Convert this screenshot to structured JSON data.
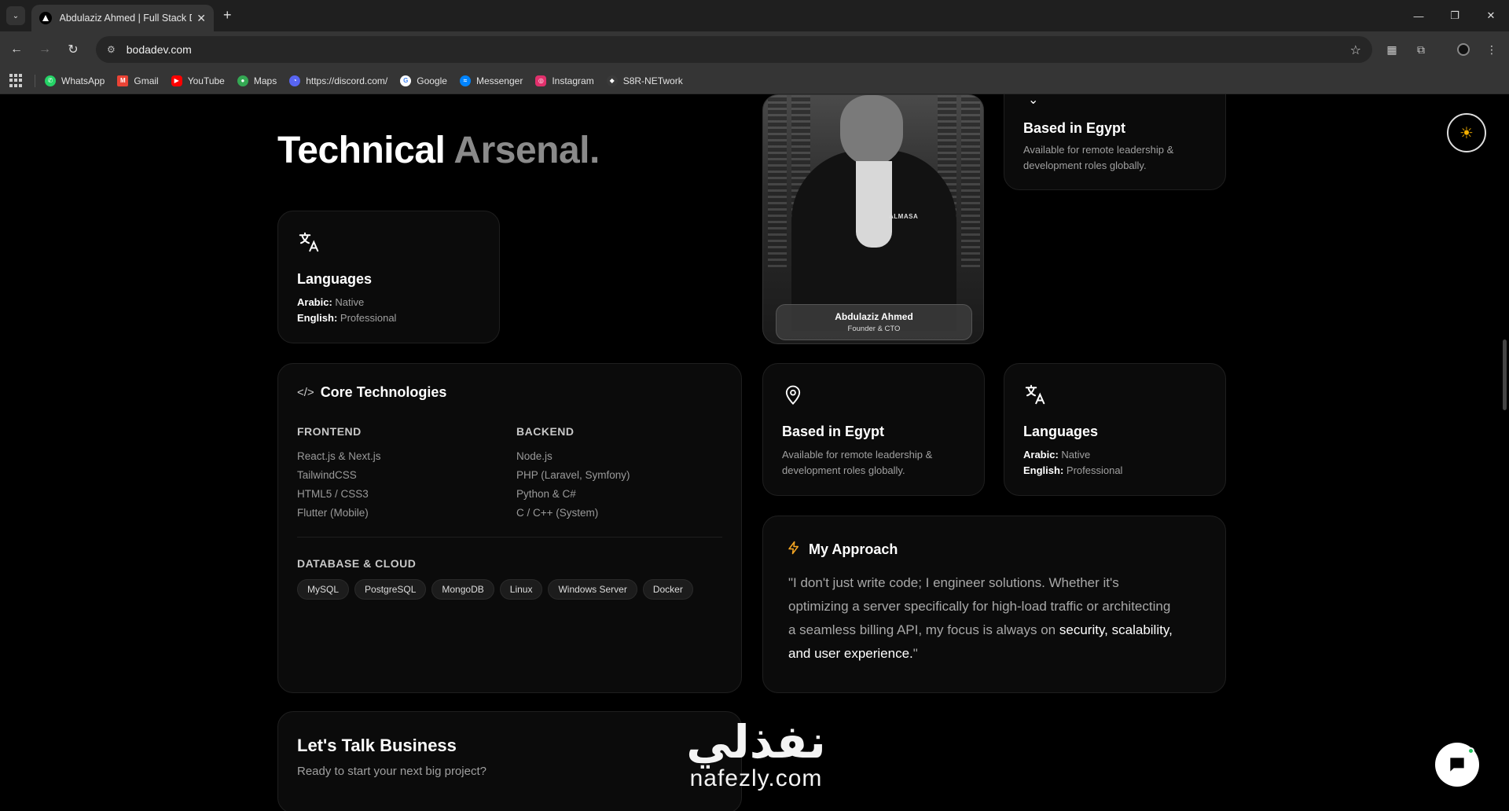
{
  "browser": {
    "tab_title": "Abdulaziz Ahmed | Full Stack Dev",
    "url": "bodadev.com",
    "bookmarks": [
      {
        "label": "WhatsApp",
        "icon": "whatsapp-icon",
        "color": "#25d366"
      },
      {
        "label": "Gmail",
        "icon": "gmail-icon",
        "color": "#ea4335"
      },
      {
        "label": "YouTube",
        "icon": "youtube-icon",
        "color": "#ff0000"
      },
      {
        "label": "Maps",
        "icon": "maps-icon",
        "color": "#34a853"
      },
      {
        "label": "https://discord.com/",
        "icon": "discord-icon",
        "color": "#5865f2"
      },
      {
        "label": "Google",
        "icon": "google-icon",
        "color": "#4285f4"
      },
      {
        "label": "Messenger",
        "icon": "messenger-icon",
        "color": "#0084ff"
      },
      {
        "label": "Instagram",
        "icon": "instagram-icon",
        "color": "#e1306c"
      },
      {
        "label": "S8R-NETwork",
        "icon": "network-icon",
        "color": "#3a3a3a"
      }
    ]
  },
  "page": {
    "title_main": "Technical",
    "title_muted": "Arsenal.",
    "languages": {
      "title": "Languages",
      "arabic_label": "Arabic:",
      "arabic_value": "Native",
      "english_label": "English:",
      "english_value": "Professional"
    },
    "profile": {
      "name": "Abdulaziz Ahmed",
      "role": "Founder & CTO",
      "shirt_logo": "ALMASA"
    },
    "location": {
      "title": "Based in Egypt",
      "line1": "Available for remote leadership &",
      "line2": "development roles globally."
    },
    "core": {
      "title": "Core Technologies",
      "frontend_head": "FRONTEND",
      "frontend": [
        "React.js & Next.js",
        "TailwindCSS",
        "HTML5 / CSS3",
        "Flutter (Mobile)"
      ],
      "backend_head": "BACKEND",
      "backend": [
        "Node.js",
        "PHP (Laravel, Symfony)",
        "Python & C#",
        "C / C++ (System)"
      ],
      "db_head": "DATABASE & CLOUD",
      "db": [
        "MySQL",
        "PostgreSQL",
        "MongoDB",
        "Linux",
        "Windows Server",
        "Docker"
      ]
    },
    "approach": {
      "title": "My Approach",
      "line1": "\"I don't just write code; I engineer solutions. Whether it's",
      "line2": "optimizing a server specifically for high-load traffic or architecting",
      "line3_a": "a seamless billing API, my focus is always on ",
      "line3_b": "security, scalability,",
      "line4_b": "and user experience.",
      "line4_end": "\""
    },
    "business": {
      "title": "Let's Talk Business",
      "subtitle": "Ready to start your next big project?"
    },
    "watermark": {
      "arabic": "نفذلي",
      "latin": "nafezly.com"
    }
  }
}
